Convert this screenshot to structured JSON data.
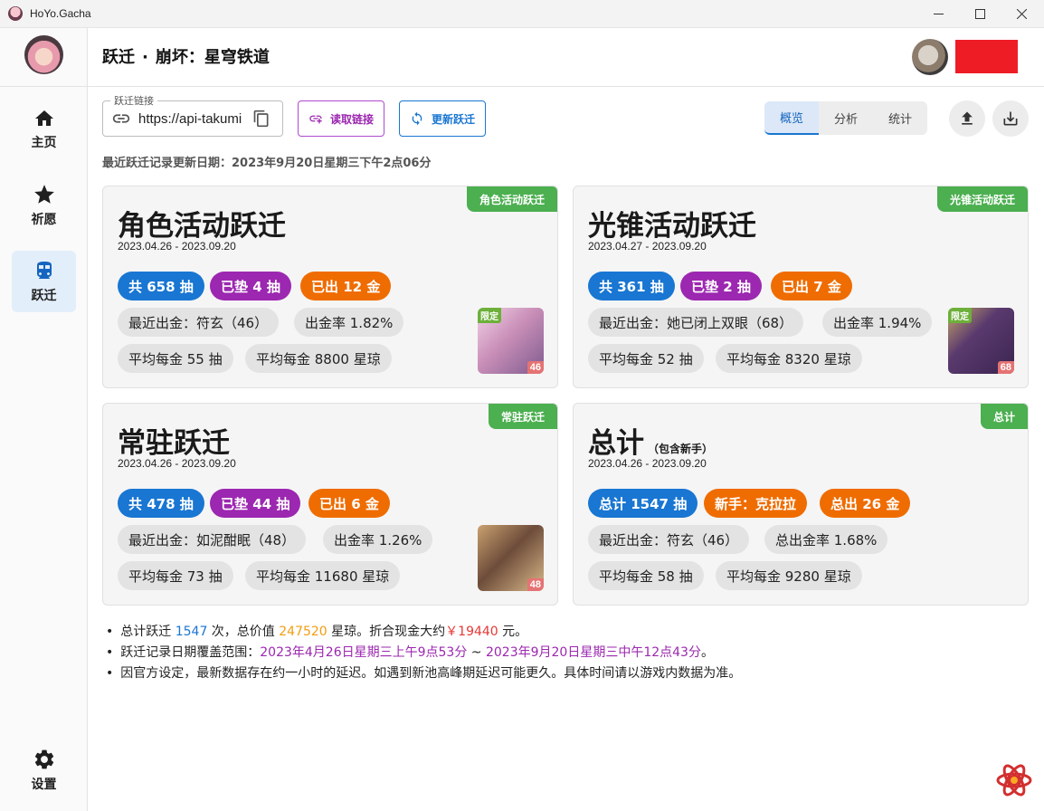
{
  "window": {
    "title": "HoYo.Gacha"
  },
  "sidebar": {
    "items": [
      {
        "label": "主页",
        "icon": "home-icon"
      },
      {
        "label": "祈愿",
        "icon": "star-icon"
      },
      {
        "label": "跃迁",
        "icon": "train-icon",
        "active": true
      },
      {
        "label": "设置",
        "icon": "gear-icon"
      }
    ]
  },
  "header": {
    "section": "跃迁",
    "separator": "·",
    "game": "崩坏：星穹铁道"
  },
  "toolbar": {
    "url_legend": "跃迁链接",
    "url_value": "https://api-takumi",
    "read_label": "读取链接",
    "update_label": "更新跃迁",
    "tabs": [
      "概览",
      "分析",
      "统计"
    ],
    "active_tab": "概览"
  },
  "update_line": "最近跃迁记录更新日期：2023年9月20日星期三下午2点06分",
  "cards": {
    "character": {
      "tag": "角色活动跃迁",
      "title": "角色活动跃迁",
      "range": "2023.04.26 - 2023.09.20",
      "total": "共 658 抽",
      "pity": "已垫 4 抽",
      "gold": "已出 12 金",
      "last": "最近出金：符玄（46）",
      "rate": "出金率 1.82%",
      "avg_pulls": "平均每金 55 抽",
      "avg_jade": "平均每金 8800 星琼",
      "thumb_limited": "限定",
      "thumb_count": "46"
    },
    "lightcone": {
      "tag": "光锥活动跃迁",
      "title": "光锥活动跃迁",
      "range": "2023.04.27 - 2023.09.20",
      "total": "共 361 抽",
      "pity": "已垫 2 抽",
      "gold": "已出 7 金",
      "last": "最近出金：她已闭上双眼（68）",
      "rate": "出金率 1.94%",
      "avg_pulls": "平均每金 52 抽",
      "avg_jade": "平均每金 8320 星琼",
      "thumb_limited": "限定",
      "thumb_count": "68"
    },
    "standard": {
      "tag": "常驻跃迁",
      "title": "常驻跃迁",
      "range": "2023.04.26 - 2023.09.20",
      "total": "共 478 抽",
      "pity": "已垫 44 抽",
      "gold": "已出 6 金",
      "last": "最近出金：如泥酣眠（48）",
      "rate": "出金率 1.26%",
      "avg_pulls": "平均每金 73 抽",
      "avg_jade": "平均每金 11680 星琼",
      "thumb_count": "48"
    },
    "total": {
      "tag": "总计",
      "title": "总计",
      "title_sub": "（包含新手）",
      "range": "2023.04.26 - 2023.09.20",
      "total": "总计 1547 抽",
      "novice": "新手：克拉拉",
      "gold": "总出 26 金",
      "last": "最近出金：符玄（46）",
      "rate": "总出金率 1.68%",
      "avg_pulls": "平均每金 58 抽",
      "avg_jade": "平均每金 9280 星琼"
    }
  },
  "notes": {
    "line1": {
      "prefix": "总计跃迁 ",
      "count": "1547",
      "mid1": " 次，总价值 ",
      "value": "247520",
      "mid2": " 星琼。折合现金大约",
      "cash": "￥19440",
      "suffix": " 元。"
    },
    "line2": {
      "prefix": "跃迁记录日期覆盖范围：",
      "start": "2023年4月26日星期三上午9点53分",
      "tilde": " ~ ",
      "end": "2023年9月20日星期三中午12点43分",
      "suffix": "。"
    },
    "line3": "因官方设定，最新数据存在约一小时的延迟。如遇到新池高峰期延迟可能更久。具体时间请以游戏内数据为准。"
  },
  "colors": {
    "blue": "#1976d2",
    "purple": "#9c27b0",
    "orange": "#ef6c00",
    "green_tag": "#4caf50",
    "redacted": "#ee1c25"
  }
}
